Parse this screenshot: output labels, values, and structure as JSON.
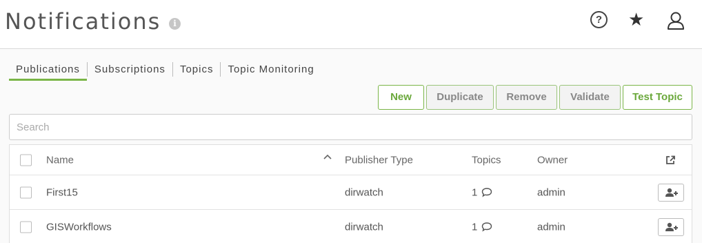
{
  "header": {
    "title": "Notifications",
    "icons": [
      "info-icon",
      "help-icon",
      "star-icon",
      "user-icon"
    ]
  },
  "tabs": [
    {
      "label": "Publications",
      "active": true
    },
    {
      "label": "Subscriptions",
      "active": false
    },
    {
      "label": "Topics",
      "active": false
    },
    {
      "label": "Topic Monitoring",
      "active": false
    }
  ],
  "toolbar": {
    "new_label": "New",
    "duplicate_label": "Duplicate",
    "remove_label": "Remove",
    "validate_label": "Validate",
    "test_topic_label": "Test Topic"
  },
  "search": {
    "placeholder": "Search",
    "value": ""
  },
  "table": {
    "columns": {
      "name": "Name",
      "publisher_type": "Publisher Type",
      "topics": "Topics",
      "owner": "Owner"
    },
    "sort": {
      "column": "name",
      "direction": "ascending"
    },
    "rows": [
      {
        "name": "First15",
        "publisher_type": "dirwatch",
        "topics": "1",
        "owner": "admin"
      },
      {
        "name": "GISWorkflows",
        "publisher_type": "dirwatch",
        "topics": "1",
        "owner": "admin"
      }
    ]
  },
  "colors": {
    "accent": "#7ab547",
    "text": "#555555",
    "border": "#dedede"
  }
}
